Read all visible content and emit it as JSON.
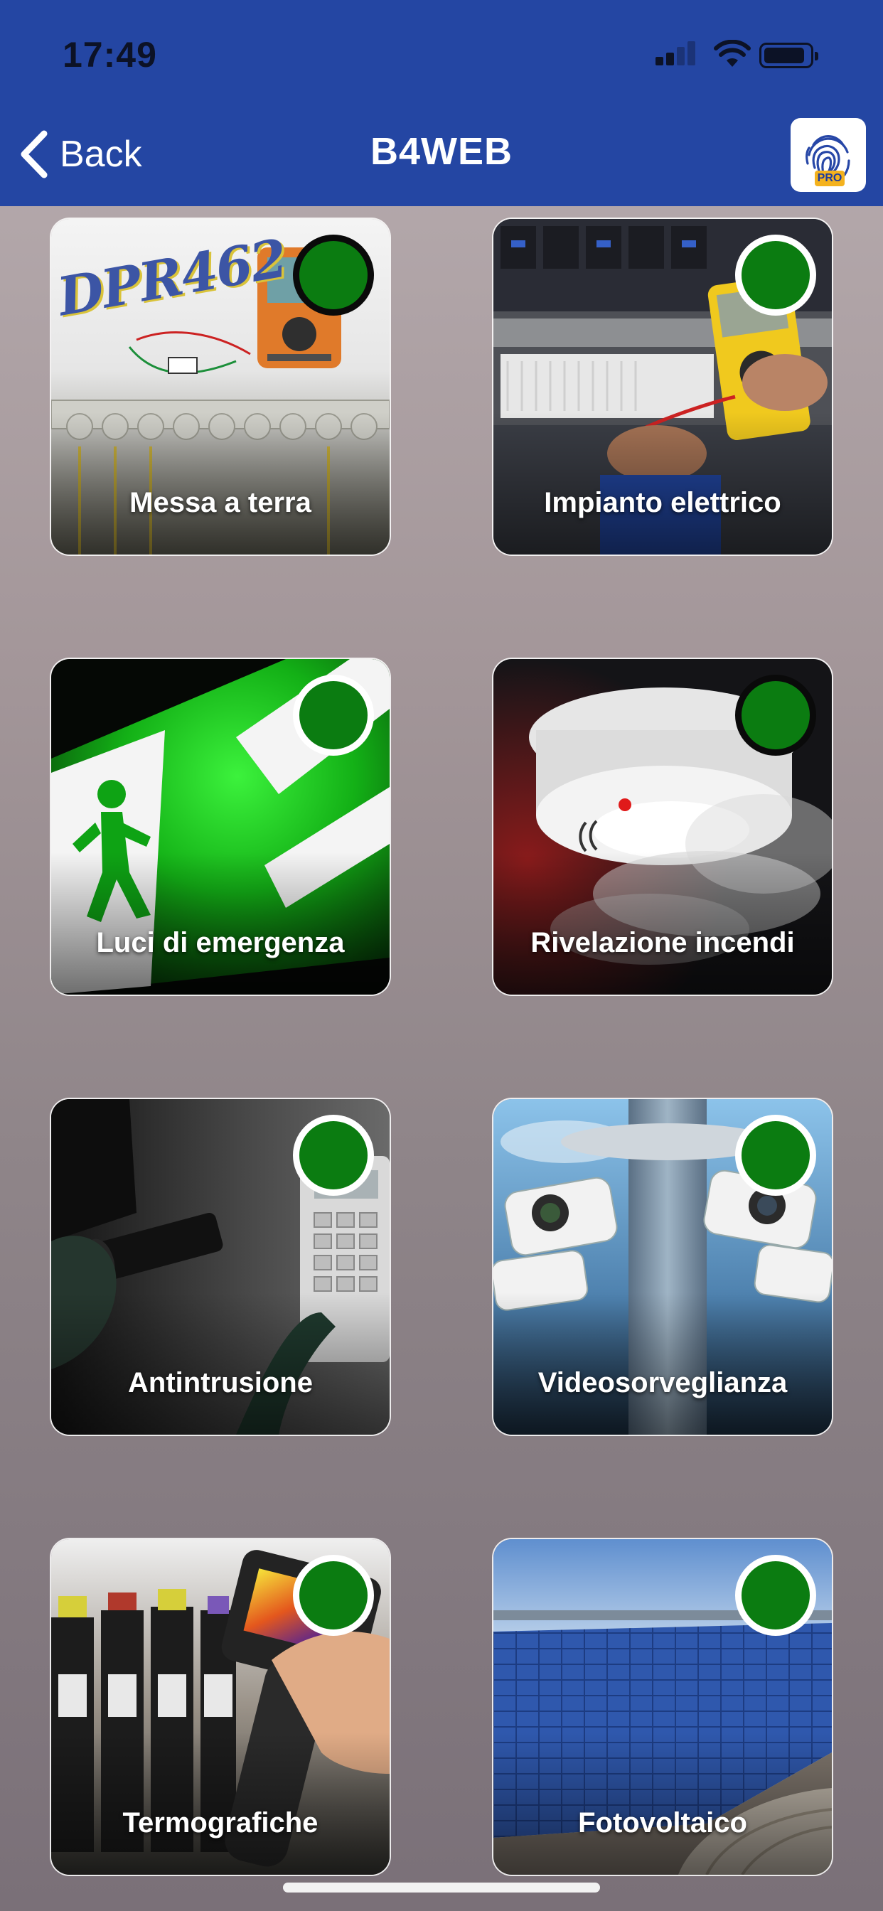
{
  "status_bar": {
    "time": "17:49"
  },
  "nav": {
    "back_label": "Back",
    "title": "B4WEB",
    "pro_badge": "PRO"
  },
  "tiles": [
    {
      "label": "Messa a terra",
      "logo_text": "DPR462",
      "status_color": "#0b7c11"
    },
    {
      "label": "Impianto elettrico",
      "status_color": "#0b7c11"
    },
    {
      "label": "Luci di emergenza",
      "status_color": "#0b7c11"
    },
    {
      "label": "Rivelazione incendi",
      "status_color": "#0b7c11"
    },
    {
      "label": "Antintrusione",
      "status_color": "#0b7c11"
    },
    {
      "label": "Videosorveglianza",
      "status_color": "#0b7c11"
    },
    {
      "label": "Termografiche",
      "status_color": "#0b7c11"
    },
    {
      "label": "Fotovoltaico",
      "status_color": "#0b7c11"
    }
  ],
  "colors": {
    "nav_bar": "#2446a3",
    "status_dot": "#0b7c11"
  }
}
